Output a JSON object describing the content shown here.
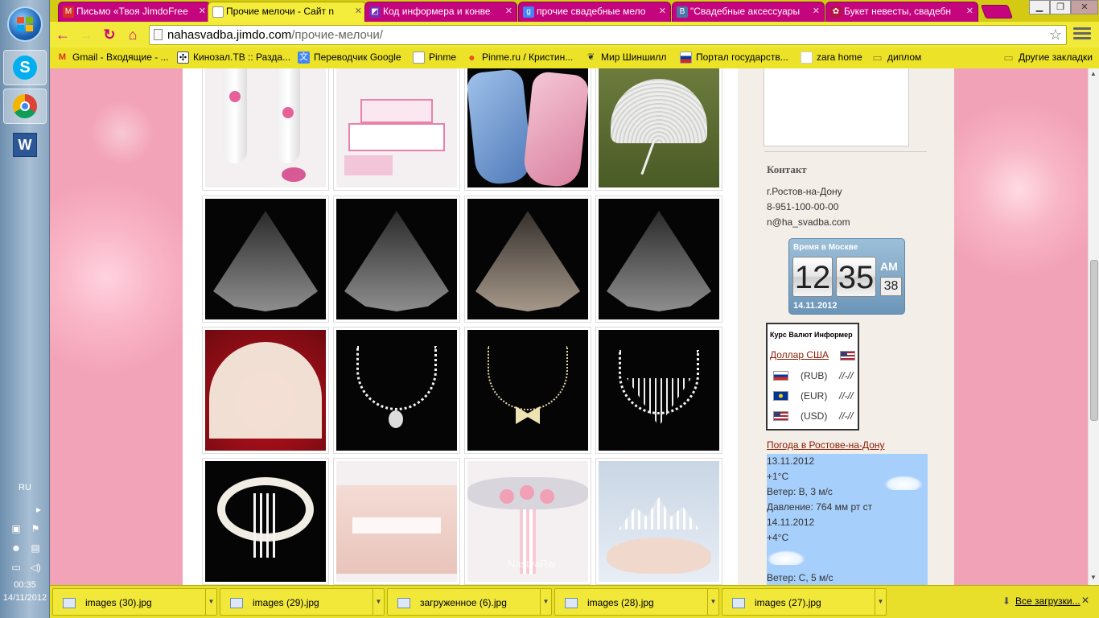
{
  "os": {
    "language": "RU",
    "clock_time": "00:35",
    "clock_date": "14/11/2012",
    "taskbar_apps": [
      "skype",
      "chrome",
      "word"
    ]
  },
  "browser": {
    "tabs": [
      {
        "label": "Письмо «Твоя JimdoFree",
        "icon": "gmail-icon",
        "active": false
      },
      {
        "label": "Прочие мелочи - Сайт n",
        "icon": "page-icon",
        "active": true
      },
      {
        "label": "Код информера и конве",
        "icon": "bookmark-icon",
        "active": false
      },
      {
        "label": "прочие свадебные мело",
        "icon": "google-icon",
        "active": false
      },
      {
        "label": "\"Свадебные аксессуары",
        "icon": "vk-icon",
        "active": false
      },
      {
        "label": "Букет невесты, свадебн",
        "icon": "flower-icon",
        "active": false
      }
    ],
    "url_domain": "nahasvadba.jimdo.com",
    "url_path": "/прочие-мелочи/",
    "bookmarks": [
      {
        "label": "Gmail - Входящие - ...",
        "icon": "gmail-icon"
      },
      {
        "label": "Кинозал.ТВ :: Разда...",
        "icon": "kinozal-icon"
      },
      {
        "label": "Переводчик Google",
        "icon": "translate-icon"
      },
      {
        "label": "Pinme",
        "icon": "page-icon"
      },
      {
        "label": "Pinme.ru / Кристин...",
        "icon": "pin-icon"
      },
      {
        "label": "Мир Шиншилл",
        "icon": "chinchilla-icon"
      },
      {
        "label": "Портал государств...",
        "icon": "russia-flag-icon"
      },
      {
        "label": "zara home",
        "icon": "blank-icon"
      },
      {
        "label": "диплом",
        "icon": "folder-icon"
      }
    ],
    "other_bookmarks": "Другие закладки"
  },
  "gallery": {
    "items": [
      {
        "name": "wedding-glasses",
        "style": "light"
      },
      {
        "name": "wedding-cake-set",
        "style": "light"
      },
      {
        "name": "satin-stockings",
        "style": "dark"
      },
      {
        "name": "lace-parasol",
        "style": "grass"
      },
      {
        "name": "veil-1",
        "style": "dark"
      },
      {
        "name": "veil-2",
        "style": "dark"
      },
      {
        "name": "veil-3",
        "style": "dark"
      },
      {
        "name": "veil-4",
        "style": "dark"
      },
      {
        "name": "lace-fan",
        "style": "red"
      },
      {
        "name": "pearl-necklace",
        "style": "dark"
      },
      {
        "name": "butterfly-necklace",
        "style": "dark"
      },
      {
        "name": "crystal-necklace-set",
        "style": "dark"
      },
      {
        "name": "garter-1",
        "style": "dark"
      },
      {
        "name": "garter-2",
        "style": "light"
      },
      {
        "name": "garter-3",
        "style": "light"
      },
      {
        "name": "tiara",
        "style": "bridal"
      }
    ],
    "watermark": "NastyaRai"
  },
  "sidebar": {
    "contact_heading": "Контакт",
    "city": "г.Ростов-на-Дону",
    "phone": "8-951-100-00-00",
    "email": "n@ha_svadba.com",
    "clock": {
      "caption": "Время в Москве",
      "hours": "12",
      "minutes": "35",
      "ampm": "AM",
      "seconds": "38",
      "date": "14.11.2012"
    },
    "currency": {
      "heading": "Курс Валют Информер",
      "base": "Доллар США",
      "rows": [
        {
          "code": "(RUB)",
          "value": "//-//",
          "flag": "ru"
        },
        {
          "code": "(EUR)",
          "value": "//-//",
          "flag": "eu"
        },
        {
          "code": "(USD)",
          "value": "//-//",
          "flag": "us"
        }
      ]
    },
    "weather": {
      "link": "Погода в Ростове-на-Дону",
      "lines": [
        "13.11.2012",
        "+1°C",
        "Ветер: В, 3 м/с",
        "Давление: 764 мм рт ст",
        "14.11.2012",
        "+4°C",
        "",
        "Ветер: С, 5 м/с"
      ]
    }
  },
  "downloads": {
    "items": [
      "images (30).jpg",
      "images (29).jpg",
      "загруженное (6).jpg",
      "images (28).jpg",
      "images (27).jpg"
    ],
    "all_label": "Все загрузки..."
  },
  "colors": {
    "chrome_yellow": "#e8df2a",
    "tab_magenta": "#c5057e",
    "link_brown": "#8a1c00",
    "weather_blue": "#a7cffb"
  }
}
